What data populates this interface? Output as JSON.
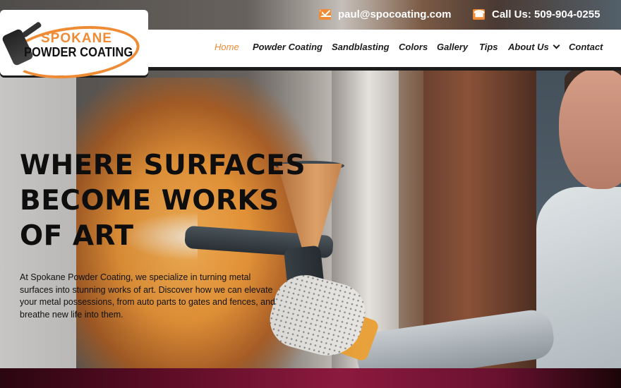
{
  "topbar": {
    "email": "paul@spocoating.com",
    "phone": "Call Us: 509-904-0255",
    "email_icon": "envelope-icon",
    "phone_icon": "phone-icon"
  },
  "logo": {
    "line1": "SPOKANE",
    "line2": "POWDER COATING"
  },
  "nav": {
    "items": [
      {
        "label": "Home",
        "active": true
      },
      {
        "label": "Powder Coating"
      },
      {
        "label": "Sandblasting"
      },
      {
        "label": "Colors"
      },
      {
        "label": "Gallery"
      },
      {
        "label": "Tips"
      },
      {
        "label": "About Us",
        "has_dropdown": true
      },
      {
        "label": "Contact"
      }
    ]
  },
  "hero": {
    "title_lines": [
      "WHERE SURFACES",
      "BECOME WORKS",
      "OF ART"
    ],
    "description": "At Spokane Powder Coating, we specialize in turning metal surfaces into stunning works of art. Discover how we can elevate your metal possessions, from auto parts to gates and fences, and breathe new life into them."
  },
  "colors": {
    "accent": "#ef8b34",
    "text_dark": "#0e0e0e",
    "nav_text": "#1d1d1d",
    "bottom_strip": "#8c1a3f"
  }
}
